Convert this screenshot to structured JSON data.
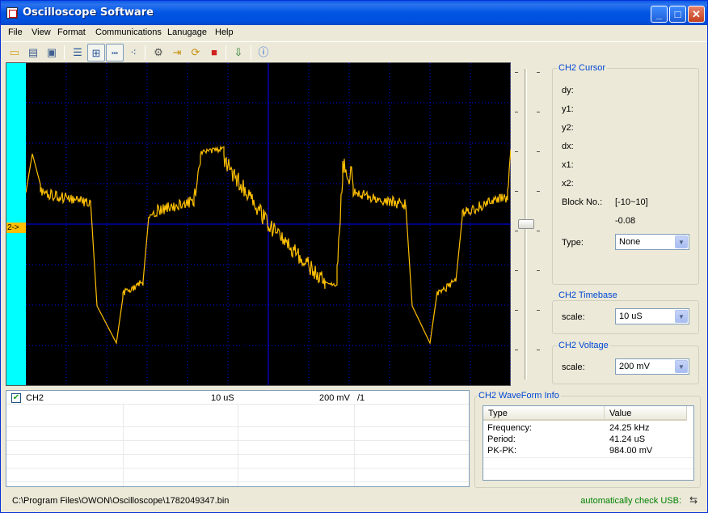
{
  "window": {
    "title": "Oscilloscope Software"
  },
  "menu": [
    "File",
    "View",
    "Format",
    "Communications",
    "Lanugage",
    "Help"
  ],
  "toolbar_icons": [
    "open-icon",
    "print-icon",
    "print-preview-icon",
    "list-icon",
    "grid-icon",
    "dotted-line-icon",
    "dots-icon",
    "settings-icon",
    "import-icon",
    "refresh-icon",
    "stop-icon",
    "export-icon",
    "help-icon"
  ],
  "scope": {
    "channel_marker": "2->",
    "trace_color": "#ffc000",
    "grid_color": "#0000ff",
    "side_color": "#00ffff"
  },
  "cursor": {
    "title": "CH2 Cursor",
    "dy_label": "dy:",
    "y1_label": "y1:",
    "y2_label": "y2:",
    "dx_label": "dx:",
    "x1_label": "x1:",
    "x2_label": "x2:",
    "block_label": "Block No.:",
    "block_range": "[-10~10]",
    "block_value": "-0.08",
    "type_label": "Type:",
    "type_value": "None"
  },
  "timebase": {
    "title": "CH2 Timebase",
    "scale_label": "scale:",
    "scale_value": "10 uS"
  },
  "voltage": {
    "title": "CH2 Voltage",
    "scale_label": "scale:",
    "scale_value": "200 mV"
  },
  "channel_list": {
    "name": "CH2",
    "checked": true,
    "timebase": "10 uS",
    "voltage": "200 mV",
    "probe": "/1"
  },
  "wfinfo": {
    "title": "CH2 WaveForm Info",
    "col_type": "Type",
    "col_value": "Value",
    "rows": [
      {
        "type": "Frequency:",
        "value": "24.25 kHz"
      },
      {
        "type": "Period:",
        "value": "41.24 uS"
      },
      {
        "type": "PK-PK:",
        "value": "984.00 mV"
      }
    ]
  },
  "status": {
    "path": "C:\\Program Files\\OWON\\Oscilloscope\\1782049347.bin",
    "usb": "automatically check USB:"
  }
}
